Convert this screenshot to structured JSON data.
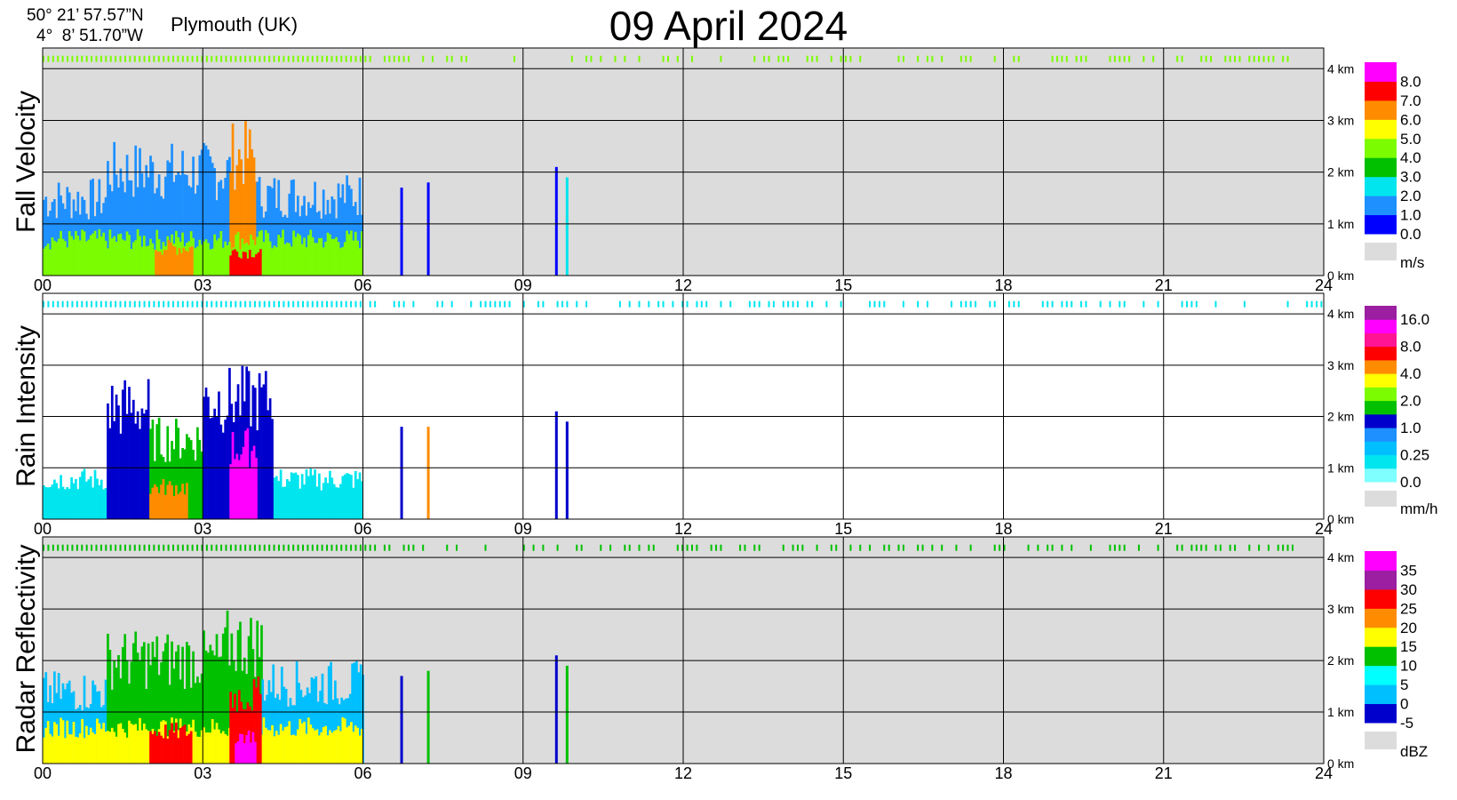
{
  "header": {
    "lat": "50° 21’ 57.57”N",
    "lon": "4°  8’ 51.70”W",
    "location": "Plymouth (UK)",
    "title": "09 April 2024"
  },
  "chart_data": [
    {
      "type": "heatmap",
      "title": "Fall Velocity",
      "background": "#dcdcdc",
      "x_ticks": [
        "00",
        "03",
        "06",
        "09",
        "12",
        "15",
        "18",
        "21",
        "24"
      ],
      "xlim": [
        0,
        24
      ],
      "y_ticks": [
        "0 km",
        "1 km",
        "2 km",
        "3 km",
        "4 km"
      ],
      "ylim_km": [
        0,
        4.4
      ],
      "unit": "m/s",
      "colorbar": [
        {
          "label": "0.0",
          "color": "#0000ff"
        },
        {
          "label": "1.0",
          "color": "#1e90ff"
        },
        {
          "label": "2.0",
          "color": "#00e5ee"
        },
        {
          "label": "3.0",
          "color": "#00c000"
        },
        {
          "label": "4.0",
          "color": "#7cfc00"
        },
        {
          "label": "5.0",
          "color": "#ffff00"
        },
        {
          "label": "6.0",
          "color": "#ff8c00"
        },
        {
          "label": "7.0",
          "color": "#ff0000"
        },
        {
          "label": "8.0",
          "color": "#ff00ff"
        }
      ],
      "rain_echoes": [
        {
          "t0": 0.0,
          "t1": 1.2,
          "top": 1.9,
          "color": "#1e90ff"
        },
        {
          "t0": 1.2,
          "t1": 3.5,
          "top": 2.6,
          "color": "#1e90ff"
        },
        {
          "t0": 3.5,
          "t1": 4.0,
          "top": 3.0,
          "color": "#ff8c00"
        },
        {
          "t0": 4.0,
          "t1": 6.0,
          "top": 2.0,
          "color": "#1e90ff"
        },
        {
          "t0": 0.0,
          "t1": 6.0,
          "top": 0.9,
          "color": "#7cfc00"
        },
        {
          "t0": 2.1,
          "t1": 2.8,
          "top": 0.7,
          "color": "#ff8c00"
        },
        {
          "t0": 3.5,
          "t1": 4.1,
          "top": 0.6,
          "color": "#ff0000"
        }
      ],
      "showers": [
        {
          "t": 6.7,
          "top": 1.7,
          "color": "#0000ff"
        },
        {
          "t": 7.2,
          "top": 1.8,
          "color": "#0000ff"
        },
        {
          "t": 9.6,
          "top": 2.1,
          "color": "#0000ff"
        },
        {
          "t": 9.8,
          "top": 1.9,
          "color": "#00e5ee"
        }
      ]
    },
    {
      "type": "heatmap",
      "title": "Rain Intensity",
      "background": "#ffffff",
      "x_ticks": [
        "00",
        "03",
        "06",
        "09",
        "12",
        "15",
        "18",
        "21",
        "24"
      ],
      "xlim": [
        0,
        24
      ],
      "y_ticks": [
        "0 km",
        "1 km",
        "2 km",
        "3 km",
        "4 km"
      ],
      "ylim_km": [
        0,
        4.4
      ],
      "unit": "mm/h",
      "colorbar": [
        {
          "label": "0.0",
          "color": "#7fffff"
        },
        {
          "label": "",
          "color": "#00e5ee"
        },
        {
          "label": "0.25",
          "color": "#00bfff"
        },
        {
          "label": "",
          "color": "#1e90ff"
        },
        {
          "label": "1.0",
          "color": "#0000cd"
        },
        {
          "label": "",
          "color": "#00c000"
        },
        {
          "label": "2.0",
          "color": "#7cfc00"
        },
        {
          "label": "",
          "color": "#ffff00"
        },
        {
          "label": "4.0",
          "color": "#ff8c00"
        },
        {
          "label": "",
          "color": "#ff0000"
        },
        {
          "label": "8.0",
          "color": "#ff1493"
        },
        {
          "label": "",
          "color": "#ff00ff"
        },
        {
          "label": "16.0",
          "color": "#9b1fa0"
        }
      ],
      "rain_echoes": [
        {
          "t0": 0.0,
          "t1": 6.0,
          "top": 1.0,
          "color": "#00e5ee"
        },
        {
          "t0": 1.2,
          "t1": 2.0,
          "top": 2.8,
          "color": "#0000cd"
        },
        {
          "t0": 2.0,
          "t1": 3.0,
          "top": 2.0,
          "color": "#00c000"
        },
        {
          "t0": 3.0,
          "t1": 4.3,
          "top": 3.0,
          "color": "#0000cd"
        },
        {
          "t0": 3.5,
          "t1": 4.0,
          "top": 1.8,
          "color": "#ff00ff"
        },
        {
          "t0": 2.0,
          "t1": 2.7,
          "top": 0.8,
          "color": "#ff8c00"
        }
      ],
      "showers": [
        {
          "t": 6.7,
          "top": 1.8,
          "color": "#0000cd"
        },
        {
          "t": 7.2,
          "top": 1.8,
          "color": "#ff8c00"
        },
        {
          "t": 9.6,
          "top": 2.1,
          "color": "#0000cd"
        },
        {
          "t": 9.8,
          "top": 1.9,
          "color": "#0000cd"
        }
      ]
    },
    {
      "type": "heatmap",
      "title": "Radar Reflectivity",
      "background": "#dcdcdc",
      "x_ticks": [
        "00",
        "03",
        "06",
        "09",
        "12",
        "15",
        "18",
        "21",
        "24"
      ],
      "xlim": [
        0,
        24
      ],
      "y_ticks": [
        "0 km",
        "1 km",
        "2 km",
        "3 km",
        "4 km"
      ],
      "ylim_km": [
        0,
        4.4
      ],
      "unit": "dBZ",
      "colorbar": [
        {
          "label": "-5",
          "color": "#0000cd"
        },
        {
          "label": "0",
          "color": "#00bfff"
        },
        {
          "label": "5",
          "color": "#00ffff"
        },
        {
          "label": "10",
          "color": "#00c000"
        },
        {
          "label": "15",
          "color": "#ffff00"
        },
        {
          "label": "20",
          "color": "#ff8c00"
        },
        {
          "label": "25",
          "color": "#ff0000"
        },
        {
          "label": "30",
          "color": "#9b1fa0"
        },
        {
          "label": "35",
          "color": "#ff00ff"
        }
      ],
      "rain_echoes": [
        {
          "t0": 0.0,
          "t1": 1.2,
          "top": 1.8,
          "color": "#00bfff"
        },
        {
          "t0": 1.2,
          "t1": 3.4,
          "top": 2.6,
          "color": "#00c000"
        },
        {
          "t0": 3.4,
          "t1": 4.1,
          "top": 3.0,
          "color": "#00c000"
        },
        {
          "t0": 4.1,
          "t1": 6.0,
          "top": 2.0,
          "color": "#00bfff"
        },
        {
          "t0": 0.0,
          "t1": 6.0,
          "top": 0.9,
          "color": "#ffff00"
        },
        {
          "t0": 2.0,
          "t1": 2.8,
          "top": 0.8,
          "color": "#ff0000"
        },
        {
          "t0": 3.5,
          "t1": 4.1,
          "top": 1.7,
          "color": "#ff0000"
        },
        {
          "t0": 3.6,
          "t1": 4.0,
          "top": 0.7,
          "color": "#ff00ff"
        }
      ],
      "showers": [
        {
          "t": 6.7,
          "top": 1.7,
          "color": "#0000cd"
        },
        {
          "t": 7.2,
          "top": 1.8,
          "color": "#00c000"
        },
        {
          "t": 9.6,
          "top": 2.1,
          "color": "#0000cd"
        },
        {
          "t": 9.8,
          "top": 1.9,
          "color": "#00c000"
        }
      ]
    }
  ]
}
